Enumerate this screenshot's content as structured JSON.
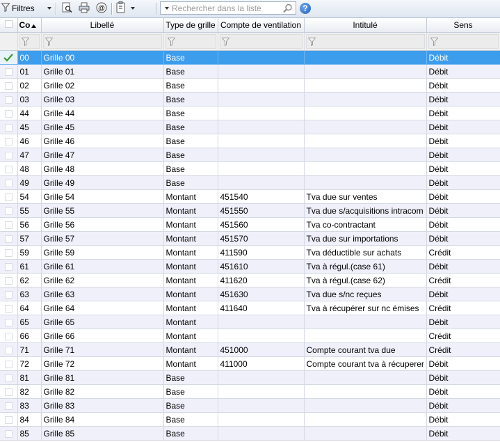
{
  "toolbar": {
    "filters_label": "Filtres",
    "search_placeholder": "Rechercher dans la liste",
    "help_glyph": "?",
    "icons": [
      "filter-icon",
      "preview-icon",
      "print-icon",
      "email-icon",
      "clipboard-icon",
      "search-icon",
      "help-icon"
    ]
  },
  "columns": {
    "code": "Co",
    "libelle": "Libellé",
    "type": "Type de grille",
    "compte": "Compte de ventilation",
    "intitule": "Intitulé",
    "sens": "Sens"
  },
  "colors": {
    "selection": "#3d9ded",
    "alt_row": "#f0f0fb",
    "checkmark": "#3a9a2a"
  },
  "rows": [
    {
      "code": "00",
      "libelle": "Grille 00",
      "type": "Base",
      "compte": "",
      "intitule": "",
      "sens": "Débit",
      "selected": true
    },
    {
      "code": "01",
      "libelle": "Grille 01",
      "type": "Base",
      "compte": "",
      "intitule": "",
      "sens": "Débit"
    },
    {
      "code": "02",
      "libelle": "Grille 02",
      "type": "Base",
      "compte": "",
      "intitule": "",
      "sens": "Débit"
    },
    {
      "code": "03",
      "libelle": "Grille 03",
      "type": "Base",
      "compte": "",
      "intitule": "",
      "sens": "Débit"
    },
    {
      "code": "44",
      "libelle": "Grille 44",
      "type": "Base",
      "compte": "",
      "intitule": "",
      "sens": "Débit"
    },
    {
      "code": "45",
      "libelle": "Grille 45",
      "type": "Base",
      "compte": "",
      "intitule": "",
      "sens": "Débit"
    },
    {
      "code": "46",
      "libelle": "Grille 46",
      "type": "Base",
      "compte": "",
      "intitule": "",
      "sens": "Débit"
    },
    {
      "code": "47",
      "libelle": "Grille 47",
      "type": "Base",
      "compte": "",
      "intitule": "",
      "sens": "Débit"
    },
    {
      "code": "48",
      "libelle": "Grille 48",
      "type": "Base",
      "compte": "",
      "intitule": "",
      "sens": "Débit"
    },
    {
      "code": "49",
      "libelle": "Grille 49",
      "type": "Base",
      "compte": "",
      "intitule": "",
      "sens": "Débit"
    },
    {
      "code": "54",
      "libelle": "Grille 54",
      "type": "Montant",
      "compte": "451540",
      "intitule": "Tva due sur ventes",
      "sens": "Débit"
    },
    {
      "code": "55",
      "libelle": "Grille 55",
      "type": "Montant",
      "compte": "451550",
      "intitule": "Tva due s/acquisitions intracom",
      "sens": "Débit"
    },
    {
      "code": "56",
      "libelle": "Grille 56",
      "type": "Montant",
      "compte": "451560",
      "intitule": "Tva co-contractant",
      "sens": "Débit"
    },
    {
      "code": "57",
      "libelle": "Grille 57",
      "type": "Montant",
      "compte": "451570",
      "intitule": "Tva due sur importations",
      "sens": "Débit"
    },
    {
      "code": "59",
      "libelle": "Grille 59",
      "type": "Montant",
      "compte": "411590",
      "intitule": "Tva déductible sur achats",
      "sens": "Crédit"
    },
    {
      "code": "61",
      "libelle": "Grille 61",
      "type": "Montant",
      "compte": "451610",
      "intitule": "Tva à régul.(case 61)",
      "sens": "Débit"
    },
    {
      "code": "62",
      "libelle": "Grille 62",
      "type": "Montant",
      "compte": "411620",
      "intitule": "Tva à régul.(case 62)",
      "sens": "Crédit"
    },
    {
      "code": "63",
      "libelle": "Grille 63",
      "type": "Montant",
      "compte": "451630",
      "intitule": "Tva due s/nc reçues",
      "sens": "Débit"
    },
    {
      "code": "64",
      "libelle": "Grille 64",
      "type": "Montant",
      "compte": "411640",
      "intitule": "Tva à récupérer sur nc émises",
      "sens": "Crédit"
    },
    {
      "code": "65",
      "libelle": "Grille 65",
      "type": "Montant",
      "compte": "",
      "intitule": "",
      "sens": "Débit"
    },
    {
      "code": "66",
      "libelle": "Grille 66",
      "type": "Montant",
      "compte": "",
      "intitule": "",
      "sens": "Crédit"
    },
    {
      "code": "71",
      "libelle": "Grille 71",
      "type": "Montant",
      "compte": "451000",
      "intitule": "Compte courant tva due",
      "sens": "Crédit"
    },
    {
      "code": "72",
      "libelle": "Grille 72",
      "type": "Montant",
      "compte": "411000",
      "intitule": "Compte courant tva à récuperer",
      "sens": "Débit"
    },
    {
      "code": "81",
      "libelle": "Grille 81",
      "type": "Base",
      "compte": "",
      "intitule": "",
      "sens": "Débit"
    },
    {
      "code": "82",
      "libelle": "Grille 82",
      "type": "Base",
      "compte": "",
      "intitule": "",
      "sens": "Débit"
    },
    {
      "code": "83",
      "libelle": "Grille 83",
      "type": "Base",
      "compte": "",
      "intitule": "",
      "sens": "Débit"
    },
    {
      "code": "84",
      "libelle": "Grille 84",
      "type": "Base",
      "compte": "",
      "intitule": "",
      "sens": "Débit"
    },
    {
      "code": "85",
      "libelle": "Grille 85",
      "type": "Base",
      "compte": "",
      "intitule": "",
      "sens": "Débit"
    }
  ]
}
